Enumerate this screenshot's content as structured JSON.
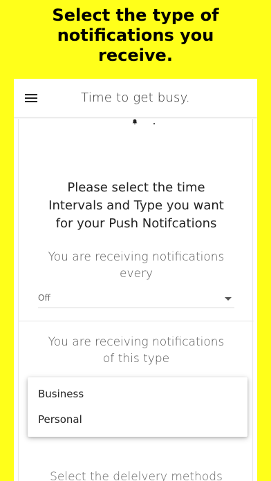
{
  "promo": {
    "line1": "Select the type of",
    "line2": "notifications you",
    "line3": "receive."
  },
  "appbar": {
    "title": "Time to get busy.",
    "menu_icon": "hamburger-menu-icon"
  },
  "intro": {
    "line1": "Please select the time",
    "line2": "Intervals and Type you want",
    "line3": "for your Push Notifcations"
  },
  "interval_section": {
    "label_line1": "You are receiving notifications",
    "label_line2": "every",
    "selected": "Off"
  },
  "type_section": {
    "label_line1": "You are receiving notifications",
    "label_line2": "of this type"
  },
  "delivery_section": {
    "label": "Select the delelvery methods"
  },
  "type_menu": {
    "options": [
      "Business",
      "Personal"
    ]
  },
  "colors": {
    "background": "#ffff1a",
    "surface": "#ffffff"
  }
}
